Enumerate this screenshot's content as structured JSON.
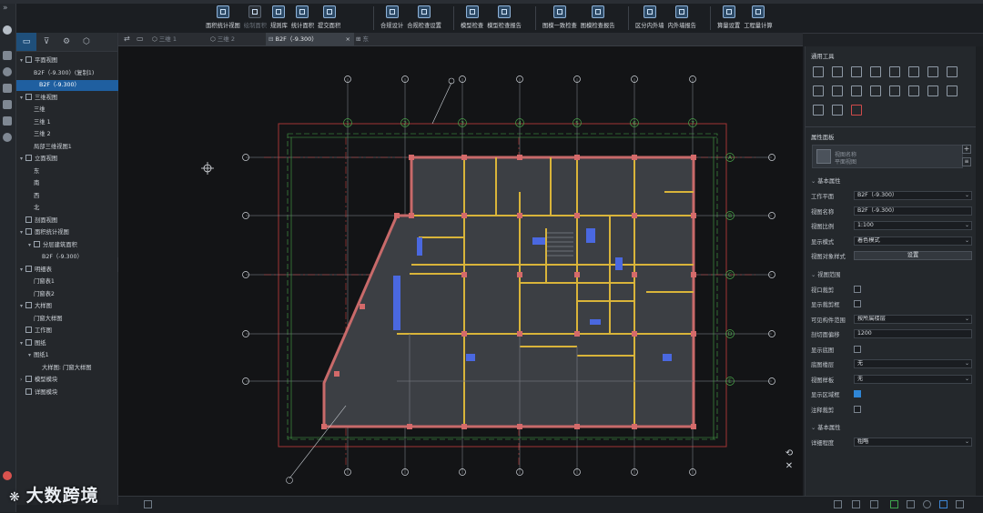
{
  "ribbon": {
    "groups": [
      {
        "items": [
          {
            "label": "面积统计视图",
            "dim": false
          },
          {
            "label": "绘制面积",
            "dim": true
          },
          {
            "label": "规则库",
            "dim": false
          },
          {
            "label": "统计面积",
            "dim": false
          },
          {
            "label": "提交面积",
            "dim": false
          }
        ]
      },
      {
        "items": [
          {
            "label": "合规设计",
            "dim": false
          },
          {
            "label": "合规检查设置",
            "dim": false
          }
        ]
      },
      {
        "items": [
          {
            "label": "模型检查",
            "dim": false
          },
          {
            "label": "模型检查报告",
            "dim": false
          }
        ]
      },
      {
        "items": [
          {
            "label": "图模一致检查",
            "dim": false
          },
          {
            "label": "图模检查报告",
            "dim": false
          }
        ]
      },
      {
        "items": [
          {
            "label": "区分内外墙",
            "dim": false
          },
          {
            "label": "内外墙报告",
            "dim": false
          }
        ]
      },
      {
        "items": [
          {
            "label": "算量设置",
            "dim": false
          },
          {
            "label": "工程量计算",
            "dim": false
          }
        ]
      }
    ]
  },
  "tree": {
    "tabs": [
      "▭",
      "⊽",
      "⚙",
      "⬡"
    ],
    "rows": [
      {
        "label": "平面视图",
        "level": 0,
        "arrow": "▾",
        "icon": true
      },
      {
        "label": "B2F（-9.300）(复制1)",
        "level": 1
      },
      {
        "label": "B2F（-9.300）",
        "level": 1,
        "selected": true
      },
      {
        "label": "三维视图",
        "level": 0,
        "arrow": "▾",
        "icon": true
      },
      {
        "label": "三维",
        "level": 1
      },
      {
        "label": "三维 1",
        "level": 1
      },
      {
        "label": "三维 2",
        "level": 1
      },
      {
        "label": "局部三维视图1",
        "level": 1
      },
      {
        "label": "立面视图",
        "level": 0,
        "arrow": "▾",
        "icon": true
      },
      {
        "label": "东",
        "level": 1
      },
      {
        "label": "南",
        "level": 1
      },
      {
        "label": "西",
        "level": 1
      },
      {
        "label": "北",
        "level": 1
      },
      {
        "label": "剖面视图",
        "level": 0,
        "arrow": "",
        "icon": true
      },
      {
        "label": "面积统计视图",
        "level": 0,
        "arrow": "▾",
        "icon": true
      },
      {
        "label": "分层建筑面积",
        "level": 1,
        "arrow": "▾",
        "icon": true
      },
      {
        "label": "B2F（-9.300）",
        "level": 2
      },
      {
        "label": "明细表",
        "level": 0,
        "arrow": "▾",
        "icon": true
      },
      {
        "label": "门窗表1",
        "level": 1
      },
      {
        "label": "门窗表2",
        "level": 1
      },
      {
        "label": "大样图",
        "level": 0,
        "arrow": "▾",
        "icon": true
      },
      {
        "label": "门窗大样图",
        "level": 1
      },
      {
        "label": "工作图",
        "level": 0,
        "arrow": "",
        "icon": true
      },
      {
        "label": "图纸",
        "level": 0,
        "arrow": "▾",
        "icon": true
      },
      {
        "label": "图纸1",
        "level": 1,
        "arrow": "▾"
      },
      {
        "label": "大样图: 门窗大样图",
        "level": 2
      },
      {
        "label": "模型模块",
        "level": 0,
        "arrow": "›",
        "icon": true
      },
      {
        "label": "详图模块",
        "level": 0,
        "arrow": "",
        "icon": true
      }
    ]
  },
  "viewtabs": [
    {
      "label": "三维 1",
      "active": false
    },
    {
      "label": "三维 2",
      "active": false
    },
    {
      "label": "B2F（-9.300）",
      "active": true
    },
    {
      "label": "东",
      "active": false
    }
  ],
  "drawing": {
    "grid_labels_top": [
      "1",
      "2",
      "3",
      "4",
      "5",
      "6",
      "7"
    ],
    "grid_labels_left": [
      "A",
      "B",
      "C",
      "D",
      "E"
    ]
  },
  "props": {
    "tools_title": "通用工具",
    "panel_title": "属性面板",
    "view_name_line1": "视图名称",
    "view_name_line2": "平面视图",
    "section_basic": "基本属性",
    "rows_basic": [
      {
        "label": "工作平面",
        "value": "B2F（-9.300）",
        "type": "select"
      },
      {
        "label": "视图名称",
        "value": "B2F（-9.300）",
        "type": "text"
      },
      {
        "label": "视图比例",
        "value": "1:100",
        "type": "select"
      },
      {
        "label": "显示模式",
        "value": "着色模式",
        "type": "select"
      },
      {
        "label": "视图对象样式",
        "value": "设置",
        "type": "button"
      }
    ],
    "section_range": "视图范围",
    "rows_range": [
      {
        "label": "视口裁剪",
        "type": "check",
        "checked": false
      },
      {
        "label": "显示裁剪框",
        "type": "check",
        "checked": false
      },
      {
        "label": "可见构件范围",
        "value": "按所属楼层",
        "type": "select"
      },
      {
        "label": "剖切面偏移",
        "value": "1200",
        "type": "text"
      },
      {
        "label": "显示底图",
        "type": "check",
        "checked": false
      },
      {
        "label": "底图楼层",
        "value": "无",
        "type": "select"
      },
      {
        "label": "视图样板",
        "value": "无",
        "type": "select"
      },
      {
        "label": "显示区域框",
        "type": "check",
        "checked": true
      },
      {
        "label": "注释裁剪",
        "type": "check",
        "checked": false
      }
    ],
    "section_basic2": "基本属性",
    "rows_basic2": [
      {
        "label": "详细程度",
        "value": "粗略",
        "type": "select"
      }
    ]
  },
  "watermark": "大数跨境"
}
